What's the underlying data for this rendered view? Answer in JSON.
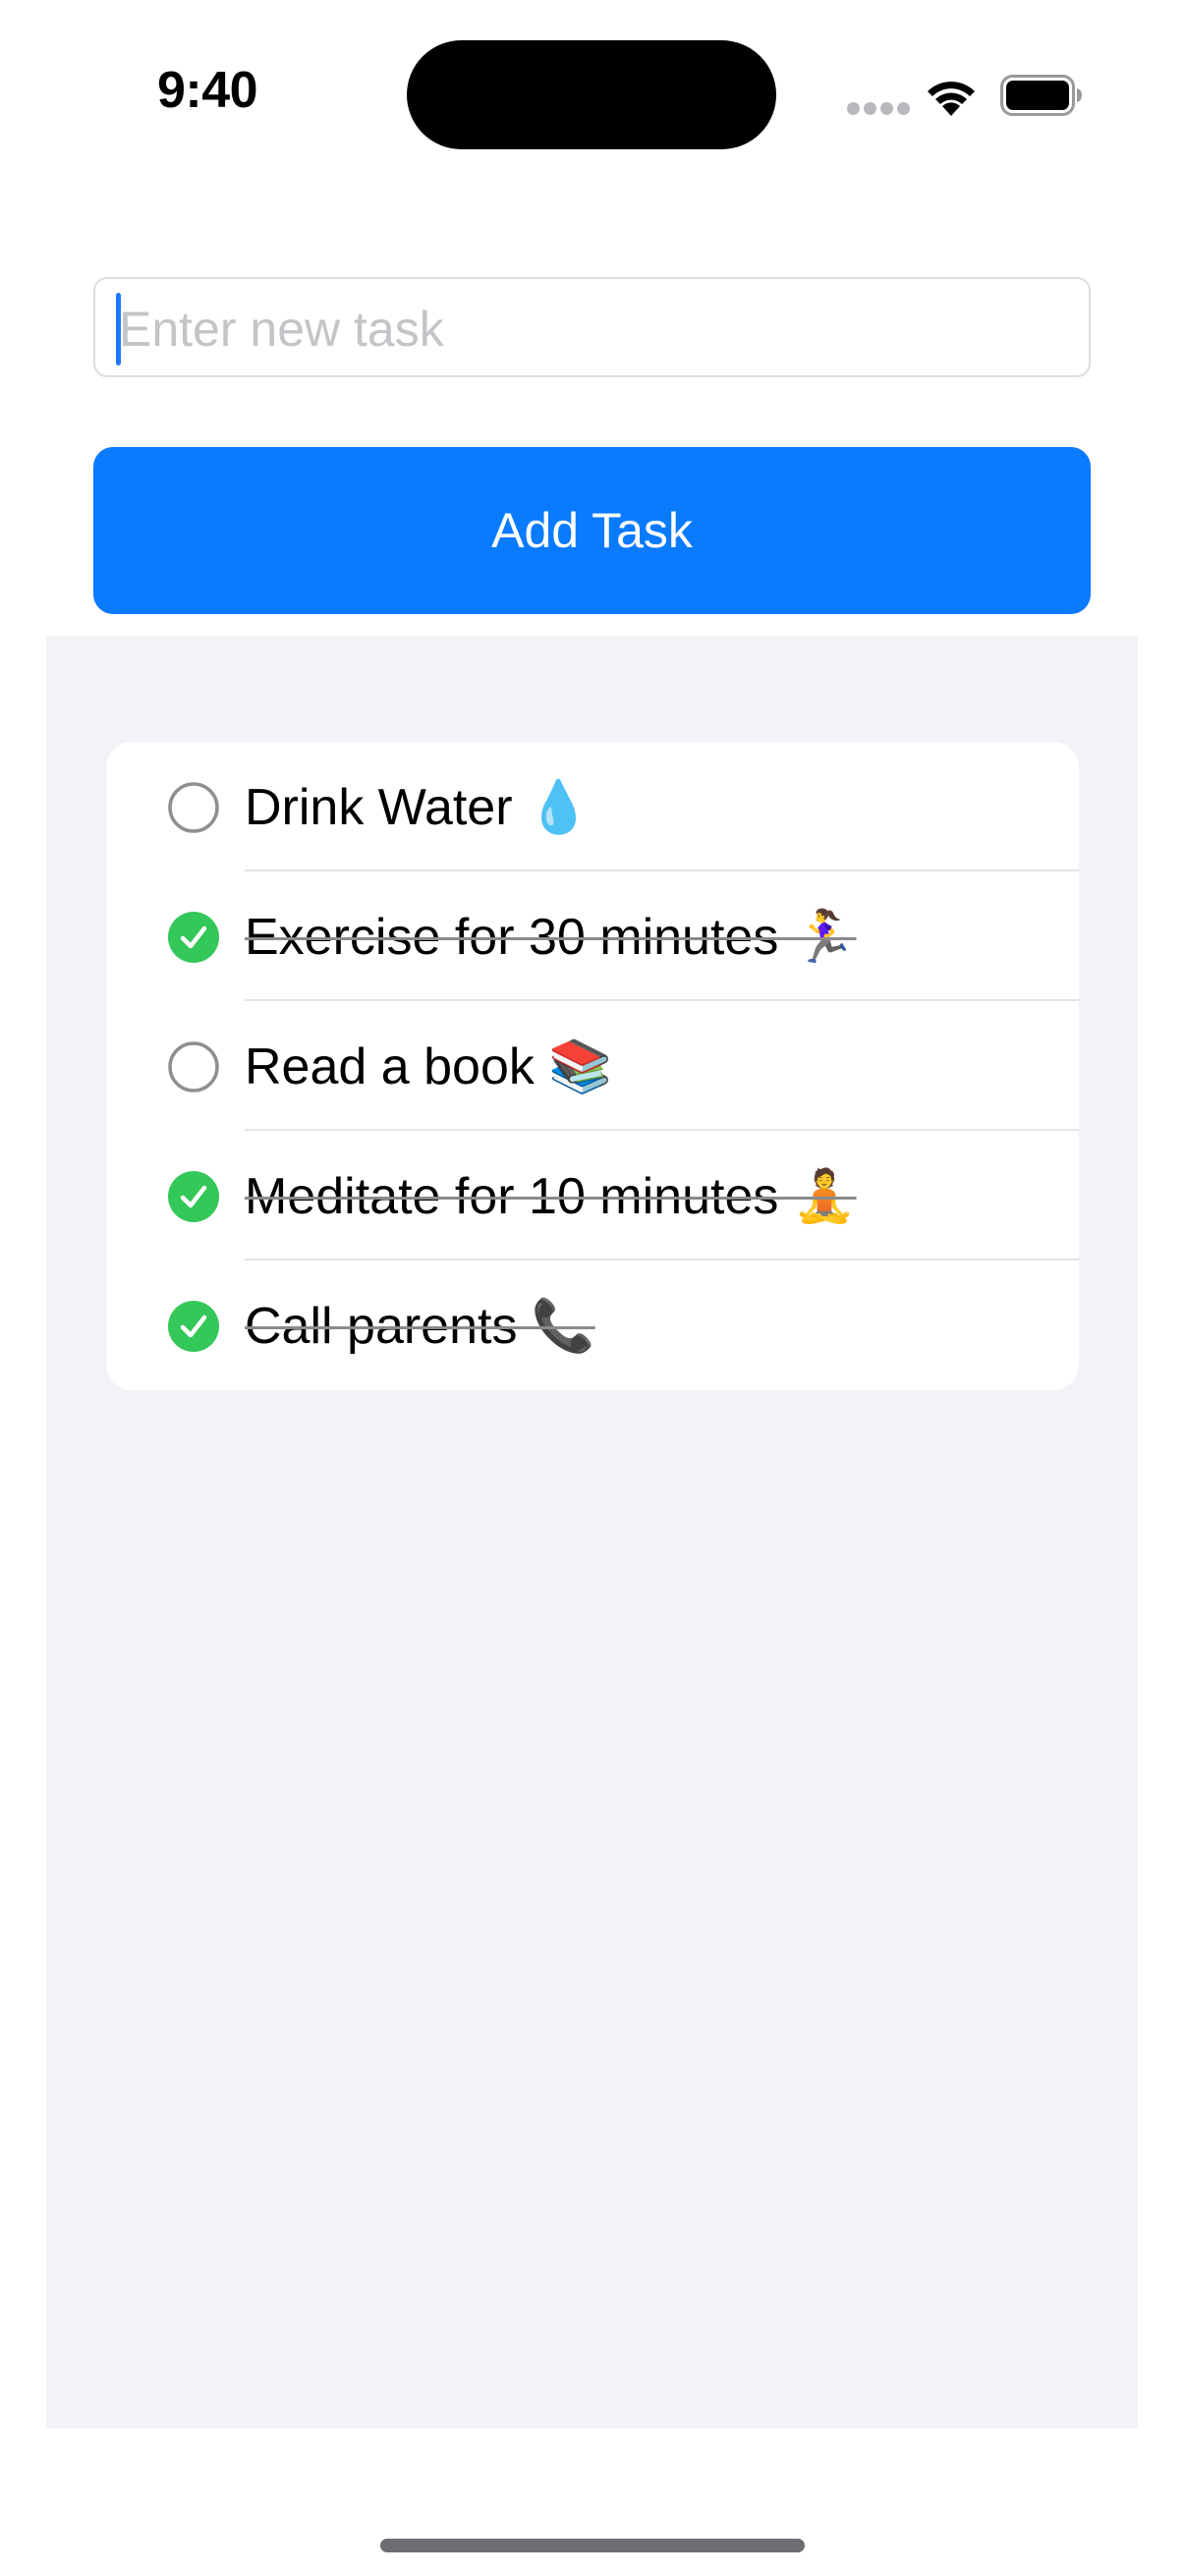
{
  "status_bar": {
    "time": "9:40",
    "icons": [
      "cellular-dots-icon",
      "wifi-icon",
      "battery-icon"
    ]
  },
  "input": {
    "placeholder": "Enter new task",
    "value": ""
  },
  "add_button": {
    "label": "Add Task",
    "color": "#0a7aff"
  },
  "tasks": [
    {
      "label": "Drink Water 💧",
      "completed": false
    },
    {
      "label": "Exercise for 30 minutes 🏃‍♀️",
      "completed": true
    },
    {
      "label": "Read a book 📚",
      "completed": false
    },
    {
      "label": "Meditate for 10 minutes 🧘",
      "completed": true
    },
    {
      "label": "Call parents 📞",
      "completed": true
    }
  ],
  "colors": {
    "accent": "#0a7aff",
    "check_done": "#34c759",
    "check_open": "#8e8e93",
    "list_background": "#f2f2f7"
  }
}
